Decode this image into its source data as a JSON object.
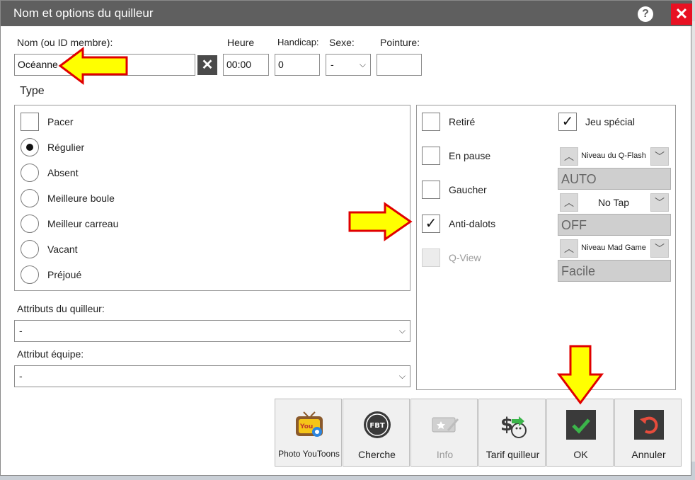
{
  "window": {
    "title": "Nom et options du quilleur",
    "help_label": "?",
    "close_label": "✕"
  },
  "fields": {
    "name_label": "Nom (ou ID membre):",
    "name_value": "Océanne",
    "clear_label": "✕",
    "time_label": "Heure",
    "time_value": "00:00",
    "handicap_label": "Handicap:",
    "handicap_value": "0",
    "sex_label": "Sexe:",
    "sex_value": "-",
    "shoe_label": "Pointure:",
    "shoe_value": ""
  },
  "type_section": {
    "title": "Type",
    "pacer_label": "Pacer",
    "options": [
      "Régulier",
      "Absent",
      "Meilleure boule",
      "Meilleur carreau",
      "Vacant",
      "Préjoué"
    ],
    "selected": "Régulier"
  },
  "attributes": {
    "bowler_label": "Attributs du quilleur:",
    "bowler_value": "-",
    "team_label": "Attribut équipe:",
    "team_value": "-"
  },
  "options_panel": {
    "retire": {
      "label": "Retiré",
      "checked": false
    },
    "pause": {
      "label": "En pause",
      "checked": false
    },
    "gaucher": {
      "label": "Gaucher",
      "checked": false
    },
    "antidalots": {
      "label": "Anti-dalots",
      "checked": true
    },
    "qview": {
      "label": "Q-View",
      "checked": false,
      "disabled": true
    },
    "jeu_special": {
      "label": "Jeu spécial",
      "checked": true
    },
    "qflash": {
      "label": "Niveau du Q-Flash",
      "value": "AUTO"
    },
    "notap": {
      "label": "No Tap",
      "value": "OFF"
    },
    "madgame": {
      "label": "Niveau Mad Game",
      "value": "Facile"
    },
    "check_mark": "✓"
  },
  "buttons": {
    "photo": "Photo YouToons",
    "cherche": "Cherche",
    "info": "Info",
    "tarif": "Tarif quilleur",
    "ok": "OK",
    "annuler": "Annuler"
  },
  "icons": {
    "photo": "youtoons-tv-icon",
    "cherche": "fbt-badge-icon",
    "info": "ticket-star-icon",
    "tarif": "dollar-bowling-icon",
    "ok": "checkmark-icon",
    "annuler": "undo-icon"
  },
  "colors": {
    "titlebar": "#5f5f5f",
    "close": "#e81123",
    "ok_icon_bg": "#3a3a3a",
    "ok_check": "#3bb54a",
    "arrow_fill": "#ffff00",
    "arrow_stroke": "#e00000"
  }
}
